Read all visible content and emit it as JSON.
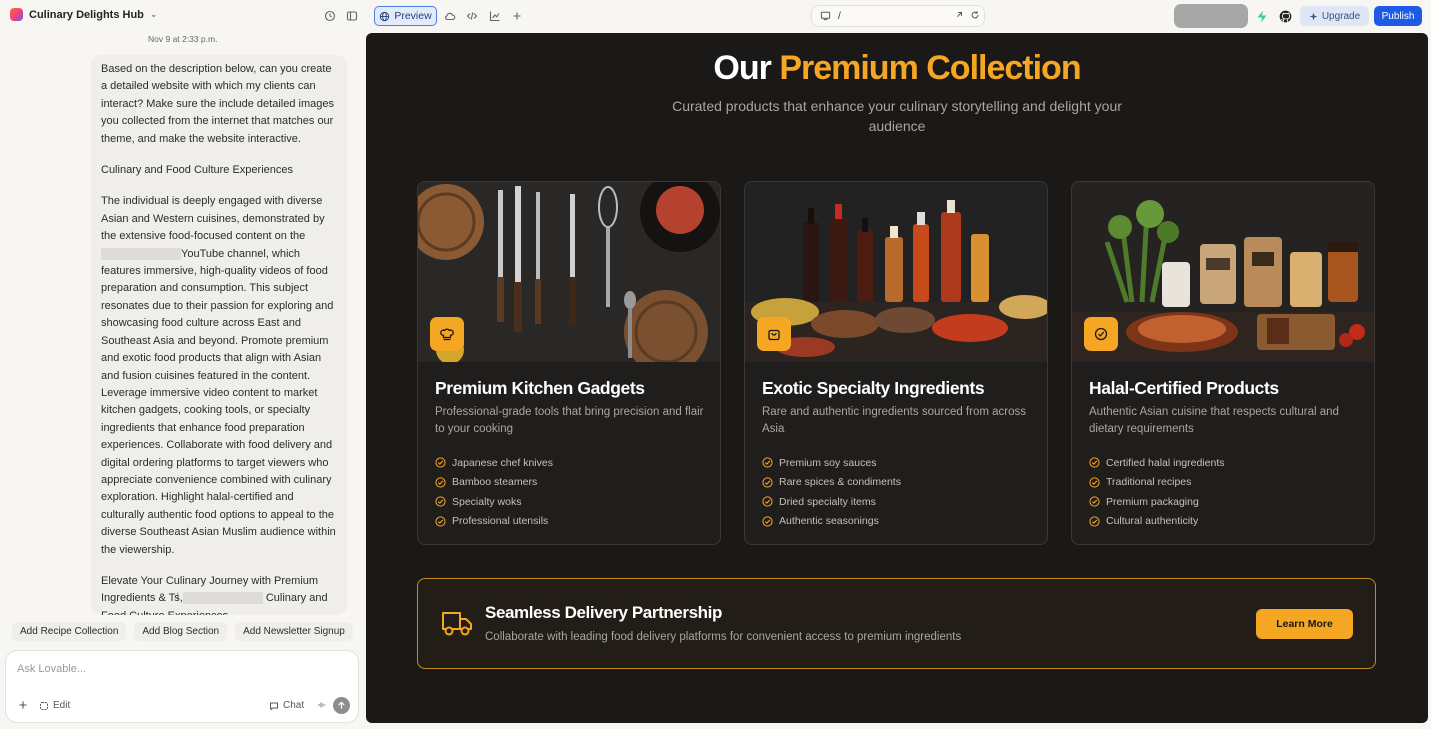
{
  "app": {
    "project_name": "Culinary Delights Hub"
  },
  "toolbar": {
    "preview_label": "Preview",
    "url_path": "/",
    "upgrade_label": "Upgrade",
    "publish_label": "Publish"
  },
  "chat": {
    "timestamp": "Nov 9 at 2:33 p.m.",
    "message_paragraphs": [
      "Based on the description below, can you create a detailed website with which my clients can interact? Make sure the include detailed images you collected from the internet that matches our theme, and make the website interactive.",
      "Culinary and Food Culture Experiences"
    ],
    "para3_before": "The individual is deeply engaged with diverse Asian and Western cuisines, demonstrated by the extensive food-focused content on the",
    "para3_after": "YouTube channel, which features immersive, high-quality videos of food preparation and consumption. This subject resonates due to their passion for exploring and showcasing food culture across East and Southeast Asia and beyond. Promote premium and exotic food products that align with Asian and fusion cuisines featured in the content. Leverage immersive video content to market kitchen gadgets, cooking tools, or specialty ingredients that enhance food preparation experiences. Collaborate with food delivery and digital ordering platforms to target viewers who appreciate convenience combined with culinary exploration. Highlight halal-certified and culturally authentic food options to appeal to the diverse Southeast Asian Muslim audience within the viewership.",
    "para4_before": "Elevate Your Culinary Journey with Premium Ingredients & T",
    "para4_mid": "s,",
    "para4_after": "Culinary and Food Culture Experiences",
    "suggestions": [
      "Add Recipe Collection",
      "Add Blog Section",
      "Add Newsletter Signup"
    ],
    "composer_placeholder": "Ask Lovable...",
    "edit_label": "Edit",
    "chat_label": "Chat"
  },
  "site": {
    "hero_title_plain": "Our ",
    "hero_title_accent": "Premium Collection",
    "hero_subtitle": "Curated products that enhance your culinary storytelling and delight your audience",
    "cards": [
      {
        "title": "Premium Kitchen Gadgets",
        "description": "Professional-grade tools that bring precision and flair to your cooking",
        "icon": "chef-hat-icon",
        "features": [
          "Japanese chef knives",
          "Bamboo steamers",
          "Specialty woks",
          "Professional utensils"
        ]
      },
      {
        "title": "Exotic Specialty Ingredients",
        "description": "Rare and authentic ingredients sourced from across Asia",
        "icon": "shopping-bag-icon",
        "features": [
          "Premium soy sauces",
          "Rare spices & condiments",
          "Dried specialty items",
          "Authentic seasonings"
        ]
      },
      {
        "title": "Halal-Certified Products",
        "description": "Authentic Asian cuisine that respects cultural and dietary requirements",
        "icon": "badge-check-icon",
        "features": [
          "Certified halal ingredients",
          "Traditional recipes",
          "Premium packaging",
          "Cultural authenticity"
        ]
      }
    ],
    "delivery": {
      "title": "Seamless Delivery Partnership",
      "description": "Collaborate with leading food delivery platforms for convenient access to premium ingredients",
      "button_label": "Learn More"
    },
    "accent_color": "#f5a623"
  }
}
